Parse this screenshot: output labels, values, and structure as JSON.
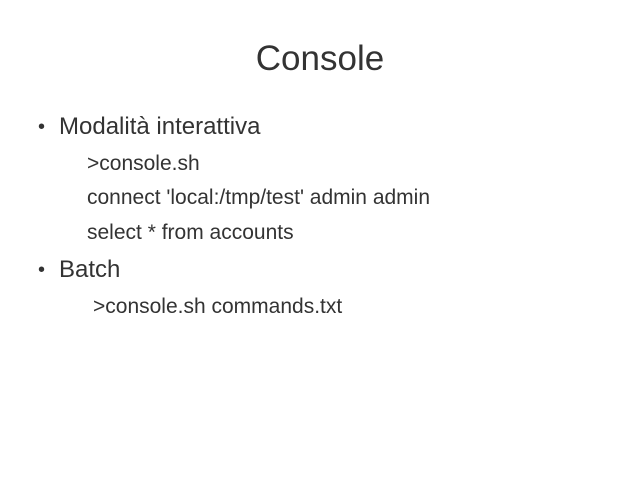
{
  "slide": {
    "title": "Console",
    "bullets": [
      {
        "label": "Modalità interattiva",
        "lines": [
          ">console.sh",
          "connect 'local:/tmp/test' admin admin",
          "select * from accounts"
        ]
      },
      {
        "label": "Batch",
        "lines": [
          ">console.sh commands.txt"
        ]
      }
    ],
    "bullet_symbol": "•",
    "text_color": "#333333",
    "background_color": "#ffffff"
  }
}
